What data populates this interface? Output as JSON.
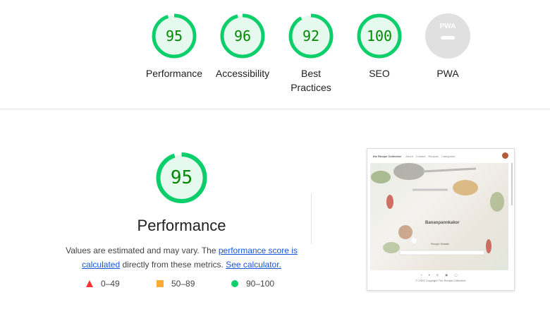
{
  "gauges": [
    {
      "score": "95",
      "label": "Performance",
      "value": 95,
      "color": "#0cce6b"
    },
    {
      "score": "96",
      "label": "Accessibility",
      "value": 96,
      "color": "#0cce6b"
    },
    {
      "score": "92",
      "label": "Best Practices",
      "value": 92,
      "color": "#0cce6b"
    },
    {
      "score": "100",
      "label": "SEO",
      "value": 100,
      "color": "#0cce6b"
    },
    {
      "score": "",
      "label": "PWA",
      "badge": "PWA",
      "color": "#cccccc"
    }
  ],
  "performance": {
    "score": "95",
    "value": 95,
    "title": "Performance",
    "desc_prefix": "Values are estimated and may vary. The ",
    "link_score": "performance score is calculated",
    "desc_mid": " directly from these metrics. ",
    "link_calc": "See calculator."
  },
  "legend": [
    {
      "range": "0–49",
      "shape": "triangle",
      "color": "#ff3333"
    },
    {
      "range": "50–89",
      "shape": "square",
      "color": "#ffaa33"
    },
    {
      "range": "90–100",
      "shape": "circle",
      "color": "#0cce6b"
    }
  ],
  "screenshot": {
    "brand": "the Recipe Collective",
    "nav": [
      "About",
      "Contact",
      "Recipes",
      "Categories"
    ],
    "recipe_title": "Bananpannkakor",
    "section": "Recipe Details",
    "footer": "© 2023 Copyright The Recipe Collective"
  }
}
